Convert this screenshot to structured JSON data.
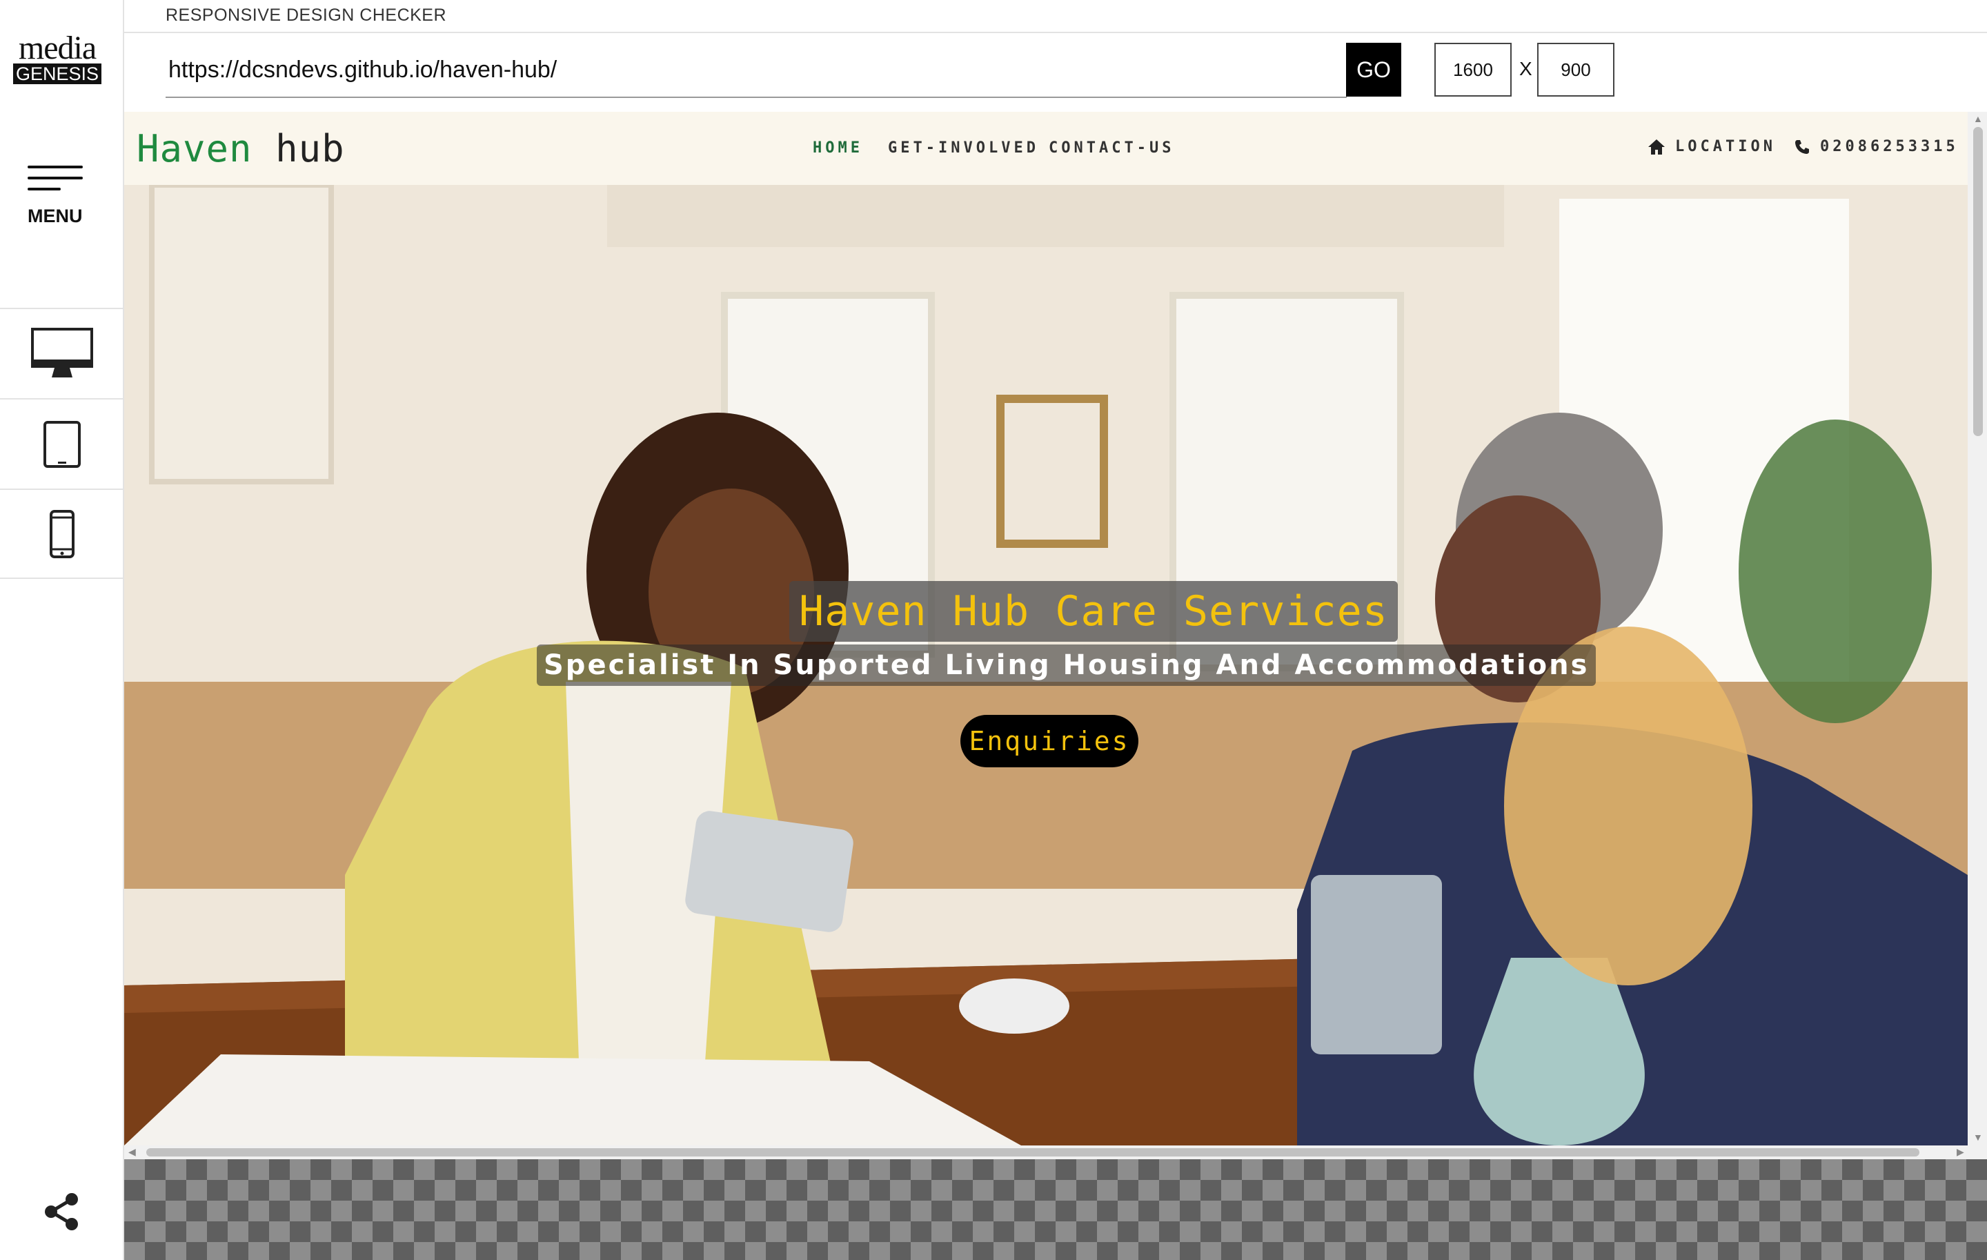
{
  "app": {
    "title": "RESPONSIVE DESIGN CHECKER",
    "logo_top": "media",
    "logo_bottom": "GENESIS",
    "menu_label": "MENU"
  },
  "toolbar": {
    "url": "https://dcsndevs.github.io/haven-hub/",
    "go_label": "GO",
    "width_value": "1600",
    "height_value": "900",
    "separator": "X"
  },
  "devices": [
    "desktop",
    "tablet",
    "mobile"
  ],
  "site": {
    "brand_first": "Haven",
    "brand_second": "hub",
    "nav": {
      "home": "HOME",
      "get_involved": "GET-INVOLVED",
      "contact": "CONTACT-US"
    },
    "location_label": "LOCATION",
    "phone": "02086253315",
    "hero": {
      "title": "Haven Hub Care Services",
      "subtitle": "Specialist In Suported Living Housing And Accommodations",
      "cta": "Enquiries",
      "image_description": "A woman in a yellow cardigan holding a medicine blister pack talks with an elderly man across a wooden table in a bright room"
    }
  },
  "colors": {
    "brand_green": "#1f8a3f",
    "accent_yellow": "#f4c20d",
    "header_bg": "#faf6ec"
  }
}
